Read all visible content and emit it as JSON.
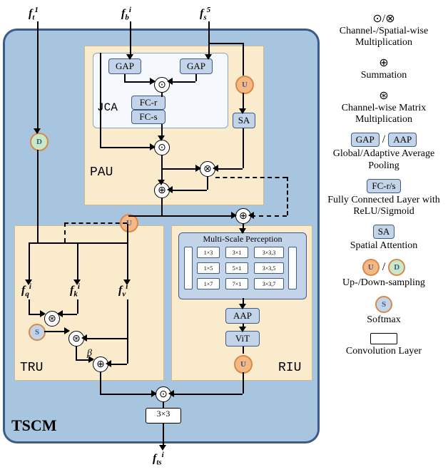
{
  "inputs": {
    "f_t": {
      "base": "f",
      "sub": "t",
      "sup": "1"
    },
    "f_b": {
      "base": "f",
      "sub": "b",
      "sup": "i"
    },
    "f_s": {
      "base": "f",
      "sub": "s",
      "sup": "5"
    }
  },
  "output": {
    "base": "f",
    "sub": "ts",
    "sup": "i"
  },
  "feats": {
    "fq": {
      "base": "f",
      "sub": "q",
      "sup": "i"
    },
    "fk": {
      "base": "f",
      "sub": "k",
      "sup": "i"
    },
    "fv": {
      "base": "f",
      "sub": "v",
      "sup": "i"
    }
  },
  "main_label": "TSCM",
  "units": {
    "pau": "PAU",
    "tru": "TRU",
    "riu": "RIU",
    "jca": "JCA"
  },
  "modules": {
    "gap": "GAP",
    "fcr": "FC-r",
    "fcs": "FC-s",
    "sa": "SA",
    "aap": "AAP",
    "vit": "ViT",
    "conv": "3×3",
    "msp": "Multi-Scale Perception"
  },
  "msp_cells": [
    [
      "1×3",
      "3×1",
      "3×3,3"
    ],
    [
      "1×5",
      "5×1",
      "3×3,5"
    ],
    [
      "1×7",
      "7×1",
      "3×3,7"
    ]
  ],
  "badges": {
    "U": "U",
    "D": "D",
    "S": "S"
  },
  "beta": "β",
  "legend": {
    "dot_cross": "⊙/⊗",
    "dot_cross_desc": "Channel-/Spatial-wise Multiplication",
    "plus": "⊕",
    "plus_desc": "Summation",
    "star": "⊛",
    "star_desc": "Channel-wise Matrix Multiplication",
    "gap_aap": "GAP",
    "gap_aap2": "AAP",
    "gap_aap_desc": "Global/Adaptive Average Pooling",
    "fc": "FC-r/s",
    "fc_desc": "Fully Connected Layer with ReLU/Sigmoid",
    "sa": "SA",
    "sa_desc": "Spatial Attention",
    "ud_u": "U",
    "ud_d": "D",
    "ud_desc": "Up-/Down-sampling",
    "s": "S",
    "s_desc": "Softmax",
    "conv_desc": "Convolution Layer"
  },
  "chart_data": {
    "type": "diagram",
    "name": "TSCM",
    "inputs": [
      "f_t^1",
      "f_b^i",
      "f_s^5"
    ],
    "output": "f_ts^i",
    "units": {
      "PAU": {
        "contains": [
          "JCA",
          "GAP",
          "GAP",
          "FC-r",
          "FC-s",
          "SA",
          "U"
        ],
        "ops": [
          "channel_mul",
          "add",
          "spatial_mul"
        ],
        "inputs": [
          "f_b^i",
          "f_s^5"
        ]
      },
      "TRU": {
        "inputs": [
          "f_t^1_downsampled",
          "PAU_out_upsampled"
        ],
        "features": [
          "f_q^i",
          "f_k^i",
          "f_v^i"
        ],
        "ops": [
          "matrix_mul",
          "softmax",
          "matrix_mul",
          "scale_beta",
          "add"
        ]
      },
      "RIU": {
        "inputs": [
          "PAU_out",
          "f_b^i"
        ],
        "contains": [
          "Multi-Scale Perception",
          "AAP",
          "ViT",
          "U"
        ],
        "msp_kernels": [
          [
            "1x3",
            "3x1",
            "3x3 d3"
          ],
          [
            "1x5",
            "5x1",
            "3x3 d5"
          ],
          [
            "1x7",
            "7x1",
            "3x3 d7"
          ]
        ]
      },
      "Fusion": {
        "ops": [
          "channel_mul",
          "3x3_conv"
        ],
        "inputs": [
          "TRU_out",
          "RIU_out"
        ]
      }
    },
    "legend_symbols": {
      "⊙": "Channel-wise Multiplication",
      "⊗": "Spatial-wise Multiplication",
      "⊕": "Summation",
      "⊛": "Channel-wise Matrix Multiplication",
      "GAP": "Global Average Pooling",
      "AAP": "Adaptive Average Pooling",
      "FC-r": "Fully Connected Layer with ReLU",
      "FC-s": "Fully Connected Layer with Sigmoid",
      "SA": "Spatial Attention",
      "U": "Up-sampling",
      "D": "Down-sampling",
      "S": "Softmax",
      "box": "Convolution Layer"
    }
  }
}
